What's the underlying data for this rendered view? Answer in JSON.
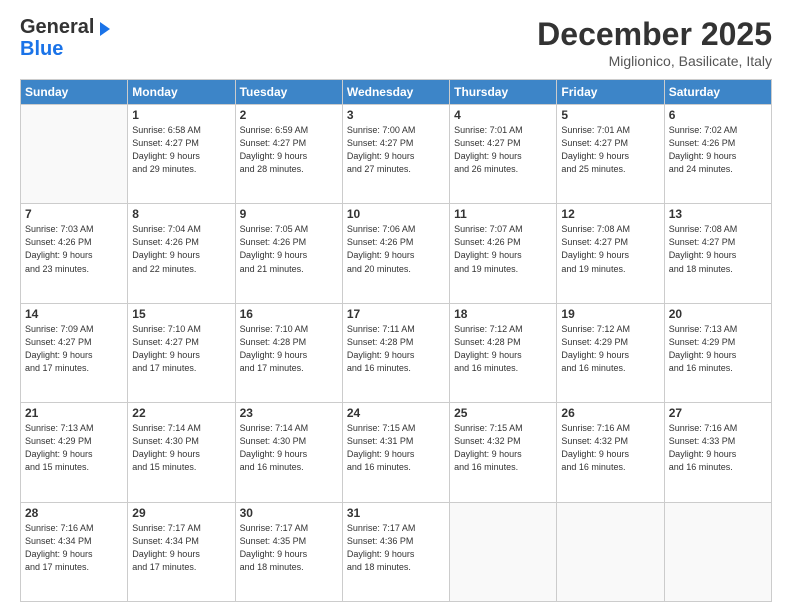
{
  "header": {
    "logo_line1": "General",
    "logo_line2": "Blue",
    "month": "December 2025",
    "location": "Miglionico, Basilicate, Italy"
  },
  "weekdays": [
    "Sunday",
    "Monday",
    "Tuesday",
    "Wednesday",
    "Thursday",
    "Friday",
    "Saturday"
  ],
  "weeks": [
    [
      {
        "day": "",
        "info": ""
      },
      {
        "day": "1",
        "info": "Sunrise: 6:58 AM\nSunset: 4:27 PM\nDaylight: 9 hours\nand 29 minutes."
      },
      {
        "day": "2",
        "info": "Sunrise: 6:59 AM\nSunset: 4:27 PM\nDaylight: 9 hours\nand 28 minutes."
      },
      {
        "day": "3",
        "info": "Sunrise: 7:00 AM\nSunset: 4:27 PM\nDaylight: 9 hours\nand 27 minutes."
      },
      {
        "day": "4",
        "info": "Sunrise: 7:01 AM\nSunset: 4:27 PM\nDaylight: 9 hours\nand 26 minutes."
      },
      {
        "day": "5",
        "info": "Sunrise: 7:01 AM\nSunset: 4:27 PM\nDaylight: 9 hours\nand 25 minutes."
      },
      {
        "day": "6",
        "info": "Sunrise: 7:02 AM\nSunset: 4:26 PM\nDaylight: 9 hours\nand 24 minutes."
      }
    ],
    [
      {
        "day": "7",
        "info": "Sunrise: 7:03 AM\nSunset: 4:26 PM\nDaylight: 9 hours\nand 23 minutes."
      },
      {
        "day": "8",
        "info": "Sunrise: 7:04 AM\nSunset: 4:26 PM\nDaylight: 9 hours\nand 22 minutes."
      },
      {
        "day": "9",
        "info": "Sunrise: 7:05 AM\nSunset: 4:26 PM\nDaylight: 9 hours\nand 21 minutes."
      },
      {
        "day": "10",
        "info": "Sunrise: 7:06 AM\nSunset: 4:26 PM\nDaylight: 9 hours\nand 20 minutes."
      },
      {
        "day": "11",
        "info": "Sunrise: 7:07 AM\nSunset: 4:26 PM\nDaylight: 9 hours\nand 19 minutes."
      },
      {
        "day": "12",
        "info": "Sunrise: 7:08 AM\nSunset: 4:27 PM\nDaylight: 9 hours\nand 19 minutes."
      },
      {
        "day": "13",
        "info": "Sunrise: 7:08 AM\nSunset: 4:27 PM\nDaylight: 9 hours\nand 18 minutes."
      }
    ],
    [
      {
        "day": "14",
        "info": "Sunrise: 7:09 AM\nSunset: 4:27 PM\nDaylight: 9 hours\nand 17 minutes."
      },
      {
        "day": "15",
        "info": "Sunrise: 7:10 AM\nSunset: 4:27 PM\nDaylight: 9 hours\nand 17 minutes."
      },
      {
        "day": "16",
        "info": "Sunrise: 7:10 AM\nSunset: 4:28 PM\nDaylight: 9 hours\nand 17 minutes."
      },
      {
        "day": "17",
        "info": "Sunrise: 7:11 AM\nSunset: 4:28 PM\nDaylight: 9 hours\nand 16 minutes."
      },
      {
        "day": "18",
        "info": "Sunrise: 7:12 AM\nSunset: 4:28 PM\nDaylight: 9 hours\nand 16 minutes."
      },
      {
        "day": "19",
        "info": "Sunrise: 7:12 AM\nSunset: 4:29 PM\nDaylight: 9 hours\nand 16 minutes."
      },
      {
        "day": "20",
        "info": "Sunrise: 7:13 AM\nSunset: 4:29 PM\nDaylight: 9 hours\nand 16 minutes."
      }
    ],
    [
      {
        "day": "21",
        "info": "Sunrise: 7:13 AM\nSunset: 4:29 PM\nDaylight: 9 hours\nand 15 minutes."
      },
      {
        "day": "22",
        "info": "Sunrise: 7:14 AM\nSunset: 4:30 PM\nDaylight: 9 hours\nand 15 minutes."
      },
      {
        "day": "23",
        "info": "Sunrise: 7:14 AM\nSunset: 4:30 PM\nDaylight: 9 hours\nand 16 minutes."
      },
      {
        "day": "24",
        "info": "Sunrise: 7:15 AM\nSunset: 4:31 PM\nDaylight: 9 hours\nand 16 minutes."
      },
      {
        "day": "25",
        "info": "Sunrise: 7:15 AM\nSunset: 4:32 PM\nDaylight: 9 hours\nand 16 minutes."
      },
      {
        "day": "26",
        "info": "Sunrise: 7:16 AM\nSunset: 4:32 PM\nDaylight: 9 hours\nand 16 minutes."
      },
      {
        "day": "27",
        "info": "Sunrise: 7:16 AM\nSunset: 4:33 PM\nDaylight: 9 hours\nand 16 minutes."
      }
    ],
    [
      {
        "day": "28",
        "info": "Sunrise: 7:16 AM\nSunset: 4:34 PM\nDaylight: 9 hours\nand 17 minutes."
      },
      {
        "day": "29",
        "info": "Sunrise: 7:17 AM\nSunset: 4:34 PM\nDaylight: 9 hours\nand 17 minutes."
      },
      {
        "day": "30",
        "info": "Sunrise: 7:17 AM\nSunset: 4:35 PM\nDaylight: 9 hours\nand 18 minutes."
      },
      {
        "day": "31",
        "info": "Sunrise: 7:17 AM\nSunset: 4:36 PM\nDaylight: 9 hours\nand 18 minutes."
      },
      {
        "day": "",
        "info": ""
      },
      {
        "day": "",
        "info": ""
      },
      {
        "day": "",
        "info": ""
      }
    ]
  ]
}
